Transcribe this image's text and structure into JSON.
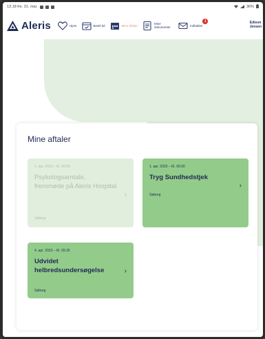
{
  "status_bar": {
    "time_date": "13.18 fre. 31. mar.",
    "right_status": "36%"
  },
  "app": {
    "brand": "Aleris",
    "colors": {
      "brand": "#1f2a55",
      "active": "#d99a7a",
      "appointment": "#93cc8a",
      "past_appointment": "#e1eedd",
      "badge": "#d9302c"
    }
  },
  "nav": {
    "items": [
      {
        "label": "Hjem",
        "icon": "heart-icon"
      },
      {
        "label": "Bestil tid",
        "icon": "calendar-check-icon"
      },
      {
        "label": "Mine aftaler",
        "icon": "calendar-icon",
        "active": true
      },
      {
        "label": "Mine dokumenter",
        "icon": "document-icon"
      },
      {
        "label": "Indbakke",
        "icon": "envelope-icon",
        "badge": "1"
      }
    ],
    "user_line1": "Edison",
    "user_line2": "Jensen"
  },
  "main": {
    "title": "Mine aftaler",
    "appointments": [
      {
        "date": "1. apr. 2023 – Kl. 08.00",
        "title": "Psykologsamtale, fremmøde på Aleris Hospital",
        "location": "Søborg",
        "state": "past"
      },
      {
        "date": "1. apr. 2023 – Kl. 09.00",
        "title": "Tryg Sundhedstjek",
        "location": "Søborg",
        "state": "upcoming"
      },
      {
        "date": "4. apr. 2023 – Kl. 09.25",
        "title": "Udvidet helbredsundersøgelse",
        "location": "Søborg",
        "state": "upcoming"
      }
    ]
  }
}
